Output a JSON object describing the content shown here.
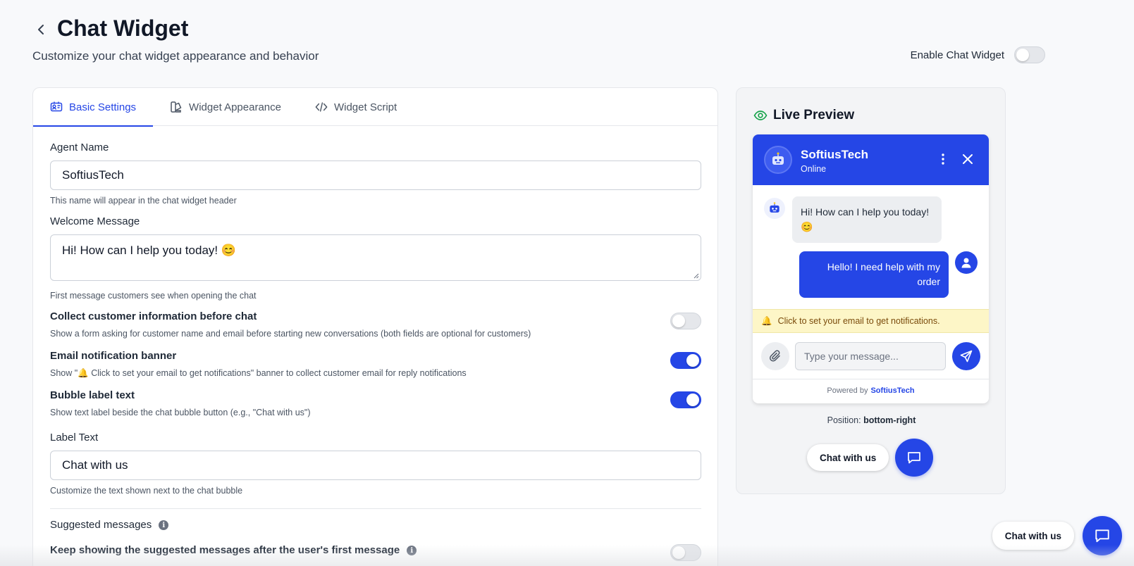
{
  "header": {
    "title": "Chat Widget",
    "subtitle": "Customize your chat widget appearance and behavior",
    "enable_label": "Enable Chat Widget",
    "enable_on": false
  },
  "tabs": [
    {
      "label": "Basic Settings",
      "icon": "id-card-icon",
      "active": true
    },
    {
      "label": "Widget Appearance",
      "icon": "palette-icon",
      "active": false
    },
    {
      "label": "Widget Script",
      "icon": "code-icon",
      "active": false
    }
  ],
  "form": {
    "agent_name": {
      "label": "Agent Name",
      "value": "SoftiusTech",
      "hint": "This name will appear in the chat widget header"
    },
    "welcome": {
      "label": "Welcome Message",
      "value": "Hi! How can I help you today! 😊",
      "hint": "First message customers see when opening the chat"
    },
    "collect_info": {
      "label": "Collect customer information before chat",
      "hint": "Show a form asking for customer name and email before starting new conversations (both fields are optional for customers)",
      "on": false
    },
    "email_banner": {
      "label": "Email notification banner",
      "hint": "Show \"🔔 Click to set your email to get notifications\" banner to collect customer email for reply notifications",
      "on": true
    },
    "bubble_label": {
      "label": "Bubble label text",
      "hint": "Show text label beside the chat bubble button (e.g., \"Chat with us\")",
      "on": true
    },
    "label_text": {
      "label": "Label Text",
      "value": "Chat with us",
      "hint": "Customize the text shown next to the chat bubble"
    },
    "suggested": {
      "label": "Suggested messages"
    },
    "keep_suggested": {
      "label": "Keep showing the suggested messages after the user's first message",
      "on": false
    }
  },
  "preview": {
    "title": "Live Preview",
    "agent_name": "SoftiusTech",
    "status": "Online",
    "bot_message": "Hi! How can I help you today! 😊",
    "user_message": "Hello! I need help with my order",
    "notification": "Click to set your email to get notifications.",
    "input_placeholder": "Type your message...",
    "powered_prefix": "Powered by",
    "powered_brand": "SoftiusTech",
    "position_prefix": "Position:",
    "position_value": "bottom-right",
    "bubble_label": "Chat with us"
  },
  "floating": {
    "bubble_label": "Chat with us"
  },
  "colors": {
    "accent": "#2546e6",
    "notify_bg": "#fdf6c7",
    "preview_eye": "#16a34a"
  }
}
